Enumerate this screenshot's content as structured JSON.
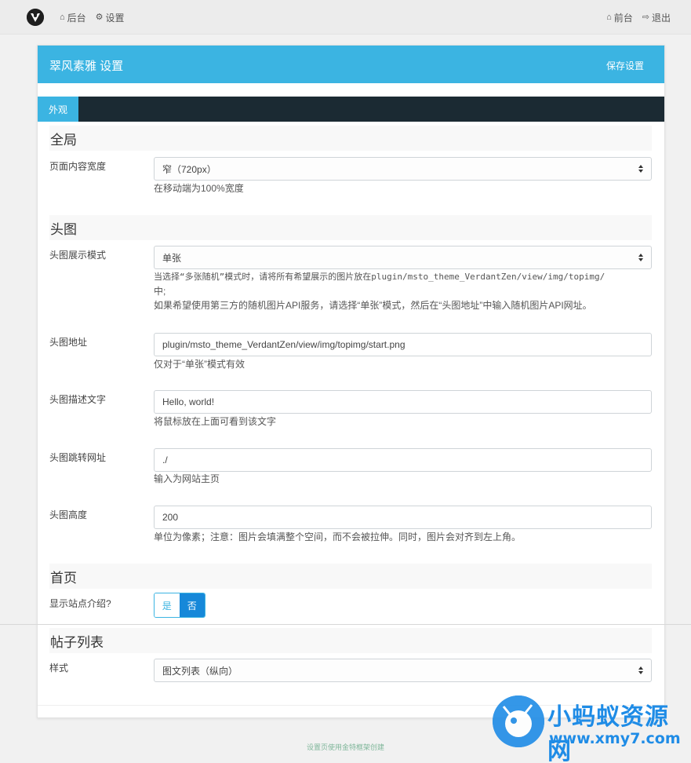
{
  "nav": {
    "backend": "后台",
    "settings": "设置",
    "frontend": "前台",
    "logout": "退出"
  },
  "panel": {
    "title": "翠风素雅 设置",
    "save": "保存设置",
    "tab": "外观"
  },
  "sections": {
    "global": "全局",
    "header_image": "头图",
    "home": "首页",
    "post_list": "帖子列表"
  },
  "fields": {
    "width": {
      "label": "页面内容宽度",
      "value": "窄（720px）",
      "help": "在移动端为100%宽度"
    },
    "mode": {
      "label": "头图展示模式",
      "value": "单张",
      "help1": "当选择“多张随机”模式时，请将所有希望展示的图片放在plugin/msto_theme_VerdantZen/view/img/topimg/",
      "help2": "中;",
      "help3": "如果希望使用第三方的随机图片API服务，请选择“单张”模式，然后在“头图地址”中输入随机图片API网址。"
    },
    "url": {
      "label": "头图地址",
      "value": "plugin/msto_theme_VerdantZen/view/img/topimg/start.png",
      "help": "仅对于“单张”模式有效"
    },
    "desc": {
      "label": "头图描述文字",
      "value": "Hello, world!",
      "help": "将鼠标放在上面可看到该文字"
    },
    "link": {
      "label": "头图跳转网址",
      "value": "./",
      "help": "输入为网站主页"
    },
    "height": {
      "label": "头图高度",
      "value": "200",
      "help": "单位为像素；注意：图片会填满整个空间，而不会被拉伸。同时，图片会对齐到左上角。"
    },
    "show_intro": {
      "label": "显示站点介绍?",
      "yes": "是",
      "no": "否",
      "selected": "否"
    },
    "style": {
      "label": "样式",
      "value": "图文列表（纵向）"
    }
  },
  "footer": "设置页使用金特框架创建",
  "watermark": {
    "title": "小蚂蚁资源网",
    "url": "www.xmy7.com"
  },
  "colors": {
    "accent": "#3bb4e2",
    "tab_bar": "#1b2a33",
    "toggle_on": "#1688d9",
    "watermark": "#1f8ce6"
  }
}
